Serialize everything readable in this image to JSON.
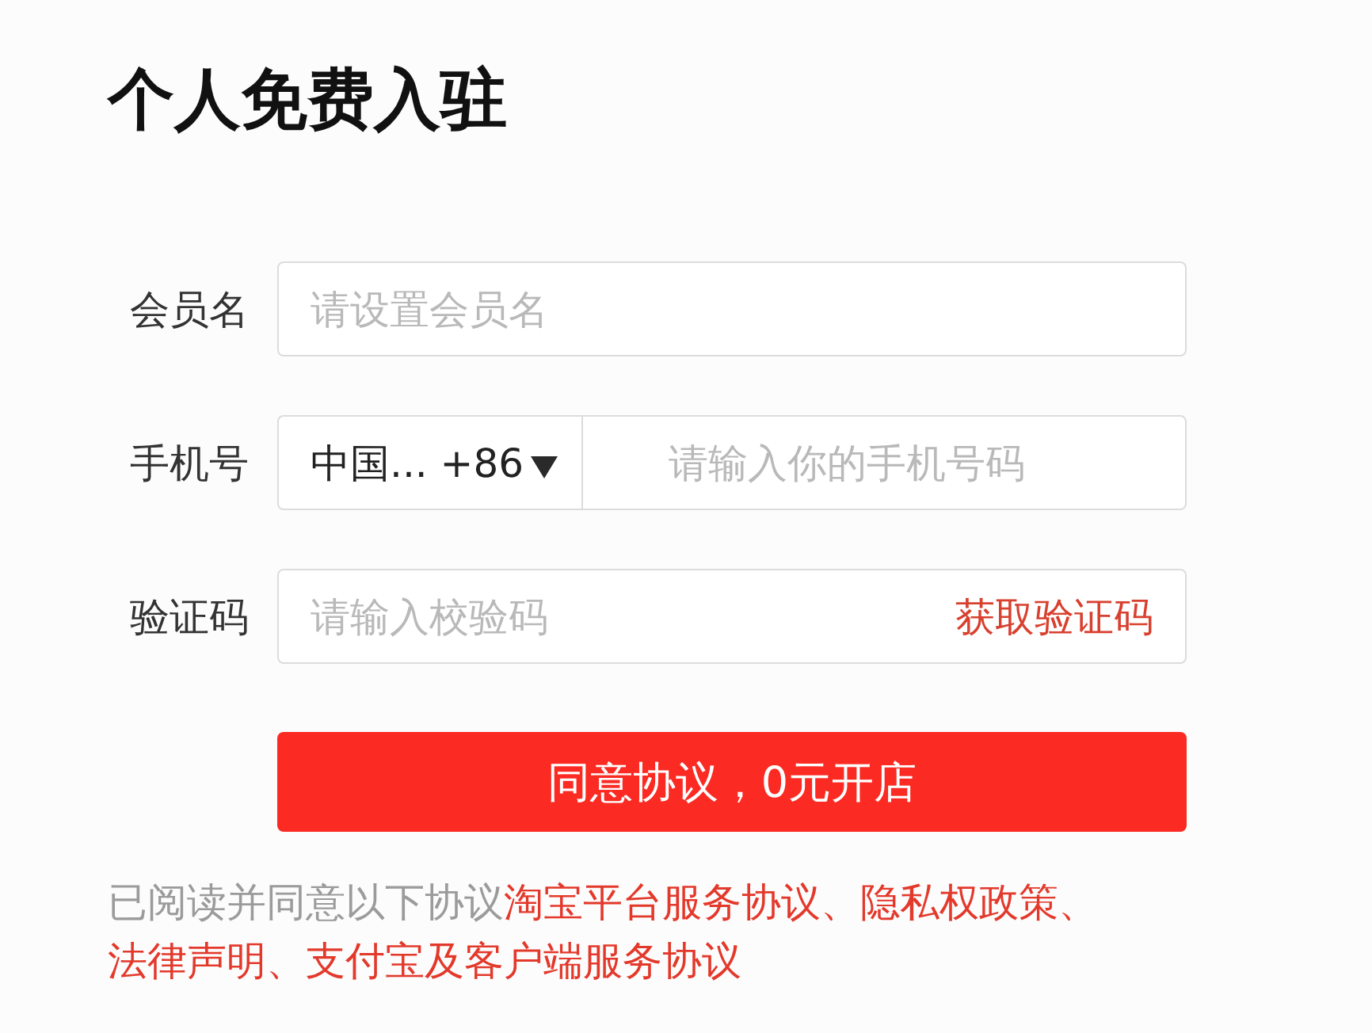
{
  "title": "个人免费入驻",
  "fields": [
    {
      "kind": "text",
      "label": "会员名",
      "placeholder": "请设置会员名"
    },
    {
      "kind": "phone",
      "label": "手机号",
      "country": "中国...",
      "dial_code": "+86",
      "placeholder": "请输入你的手机号码"
    },
    {
      "kind": "code",
      "label": "验证码",
      "placeholder": "请输入校验码",
      "action": "获取验证码"
    }
  ],
  "submit": {
    "label": "同意协议，0元开店"
  },
  "agreement": [
    {
      "kind": "text",
      "text": "已阅读并同意以下协议"
    },
    {
      "kind": "link",
      "text": "淘宝平台服务协议"
    },
    {
      "kind": "separator",
      "text": "、"
    },
    {
      "kind": "link",
      "text": "隐私权政策"
    },
    {
      "kind": "separator",
      "text": "、"
    },
    {
      "kind": "link",
      "text": "法律声明"
    },
    {
      "kind": "separator",
      "text": "、"
    },
    {
      "kind": "link",
      "text": "支付宝及客户端服务协议"
    }
  ]
}
